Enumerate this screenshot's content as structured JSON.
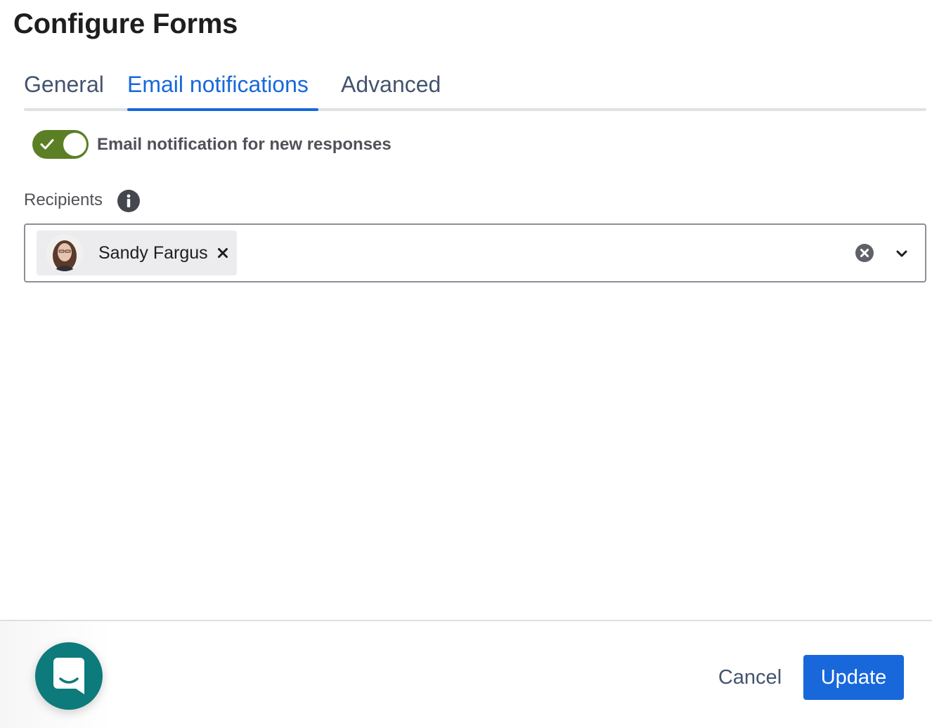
{
  "page": {
    "title": "Configure Forms"
  },
  "tabs": [
    {
      "label": "General",
      "active": false
    },
    {
      "label": "Email notifications",
      "active": true
    },
    {
      "label": "Advanced",
      "active": false
    }
  ],
  "notifications": {
    "toggle_label": "Email notification for new responses",
    "toggle_on": true,
    "toggle_color": "#5b7f24"
  },
  "recipients": {
    "label": "Recipients",
    "info_icon": "info-icon",
    "selected": [
      {
        "name": "Sandy Fargus",
        "avatar": "user-photo"
      }
    ],
    "clear_icon": "clear-circle-icon",
    "dropdown_icon": "chevron-down-icon"
  },
  "footer": {
    "cancel_label": "Cancel",
    "update_label": "Update",
    "primary_color": "#1868db"
  },
  "chat_launcher": {
    "icon": "chat-bubble-icon",
    "color": "#0d7a7c"
  }
}
